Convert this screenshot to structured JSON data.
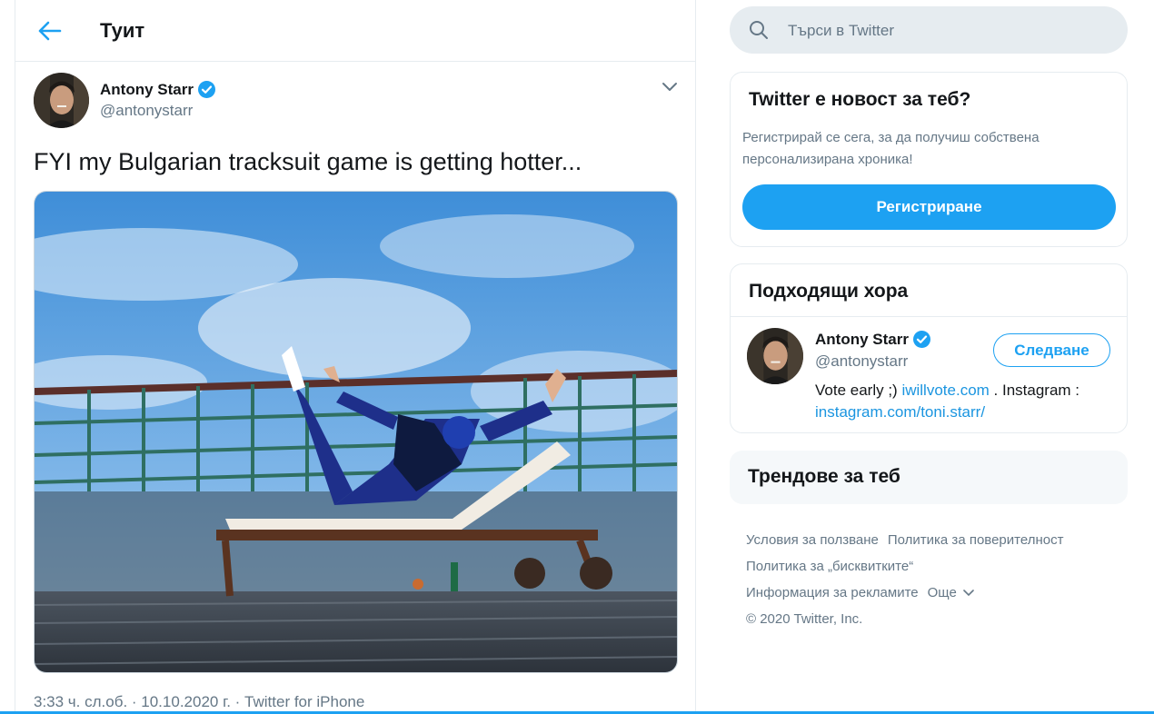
{
  "header": {
    "title": "Туит"
  },
  "tweet": {
    "author_name": "Antony Starr",
    "author_handle": "@antonystarr",
    "text": "FYI my Bulgarian tracksuit game is getting hotter...",
    "meta": "3:33 ч. сл.об. · 10.10.2020 г. · Twitter for iPhone"
  },
  "search": {
    "placeholder": "Търси в Twitter"
  },
  "signup_card": {
    "title": "Twitter е новост за теб?",
    "text": "Регистрирай се сега, за да получиш собствена персонализирана хроника!",
    "button": "Регистриране"
  },
  "people_card": {
    "title": "Подходящи хора",
    "name": "Antony Starr",
    "handle": "@antonystarr",
    "follow": "Следване",
    "bio_prefix": "Vote early ;)",
    "bio_link1": "iwillvote.com",
    "bio_middle": ". Instagram :",
    "bio_link2": "instagram.com/toni.starr/"
  },
  "trends_card": {
    "title": "Трендове за теб"
  },
  "footer": {
    "terms": "Условия за ползване",
    "privacy": "Политика за поверителност",
    "cookies": "Политика за „бисквитките“",
    "ads": "Информация за рекламите",
    "more": "Още",
    "copyright": "© 2020 Twitter, Inc."
  },
  "colors": {
    "accent": "#1da1f2",
    "link": "#1b95e0",
    "muted": "#657786",
    "border": "#e6ecf0"
  }
}
